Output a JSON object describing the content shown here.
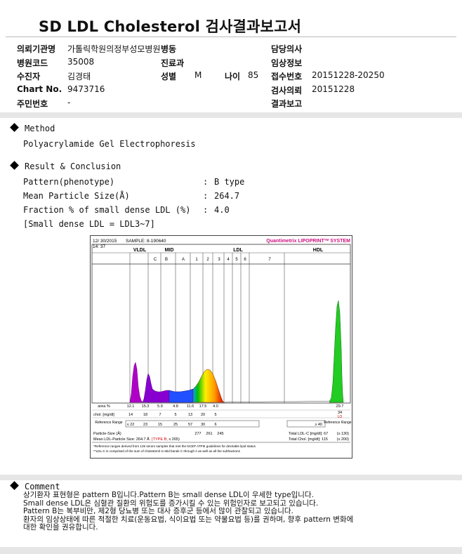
{
  "title": "SD LDL Cholesterol 검사결과보고서",
  "header": {
    "institution_label": "의뢰기관명",
    "institution_value": "가톨릭학원의정부성모병원",
    "ward_label": "병동",
    "doctor_label": "담당의사",
    "hospital_code_label": "병원코드",
    "hospital_code_value": "35008",
    "dept_label": "진료과",
    "clinical_info_label": "임상정보",
    "patient_label": "수진자",
    "patient_value": "김경태",
    "sex_label": "성별",
    "sex_value": "M",
    "age_label": "나이",
    "age_value": "85",
    "receipt_label": "접수번호",
    "receipt_value": "20151228-20250",
    "chart_label": "Chart No.",
    "chart_value": "9473716",
    "request_label": "검사의뢰",
    "request_value": "20151228",
    "id_label": "주민번호",
    "id_value": "-",
    "report_label": "결과보고"
  },
  "method": {
    "heading": "Method",
    "text": "Polyacrylamide Gel Electrophoresis"
  },
  "result": {
    "heading": "Result & Conclusion",
    "rows": [
      {
        "label": "Pattern(phenotype)",
        "colon": ":",
        "value": "B type"
      },
      {
        "label": "Mean Particle Size(Å)",
        "colon": ":",
        "value": "264.7"
      },
      {
        "label": "Fraction % of small dense LDL (%)",
        "colon": ":",
        "value": "4.0"
      }
    ],
    "note": "[Small dense LDL = LDL3~7]"
  },
  "chart_data": {
    "type": "area",
    "date": "12/ 30/2015",
    "time": "14: 37",
    "sample": "SAMPLE:   8-190640",
    "brand": "Quantimetrix LIPOPRINT",
    "brand_tm": "TM",
    "brand_suffix": " SYSTEM",
    "band_headers": {
      "vldl": "VLDL",
      "mid": "MID",
      "ldl": "LDL",
      "hdl": "HDL"
    },
    "mid_bands": [
      "C",
      "B",
      "A"
    ],
    "ldl_bands": [
      "1",
      "2",
      "3",
      "4",
      "5",
      "6",
      "7"
    ],
    "area_label": "area %",
    "area_values": [
      "12.1",
      "15.3",
      "5.9",
      "4.8",
      "11.6",
      "17.5",
      "4.0"
    ],
    "area_hdl": "29.7",
    "chol_label": "chol. [mg/dl]",
    "chol_values": [
      "14",
      "18",
      "7",
      "5",
      "13",
      "20",
      "5"
    ],
    "chol_hdl": "34",
    "chol_hdl_flag": "LO",
    "ref_label": "Reference Range",
    "ref_values": [
      "≤ 22",
      "23",
      "15",
      "25",
      "57",
      "30",
      "6"
    ],
    "ref_hdl": "≥ 40",
    "ref_label_right": "Reference Range",
    "particle_label": "Particle-Size (Å)",
    "particle_values": [
      "277",
      "261",
      "245"
    ],
    "total_ldl": "Total LDL-C [mg/dl]:  67",
    "total_ldl_ref": "(≤ 130)",
    "mean_ldl": "Mean LDL-Particle Size:  264.7 Å",
    "mean_type": "(TYPE B",
    "mean_type_ref": "; ≤ 265)",
    "total_chol": "Total Chol. [mg/dl]:  115",
    "total_chol_ref": "(≤ 200)",
    "footnote1": "*Reference ranges derived from 125 serum samples that met the NCEP ATPIII guidelines for desirable lipid status",
    "footnote2": "**LDL-C is comprised of the sum of cholesterol in Mid bands C through A as well as all the subfractions"
  },
  "comment": {
    "heading": "Comment",
    "lines": [
      "상기환자 표현형은 pattern B입니다.Pattern B는 small dense LDL이 우세한 type입니다.",
      "Small dense LDL은 심혈관 질환의 위험도를 증가시킬 수 있는 위험인자로 보고되고 있습니다.",
      "Pattern B는 복부비만, 제2형 당뇨병 또는 대사 증후군 등에서 많이 관찰되고 있습니다.",
      "환자의 임상상태에 따른 적절한 치료(운동요법, 식이요법 또는 약물요법 등)를 권하며, 향후 pattern 변화에",
      "대한 확인을 권유합니다."
    ]
  }
}
